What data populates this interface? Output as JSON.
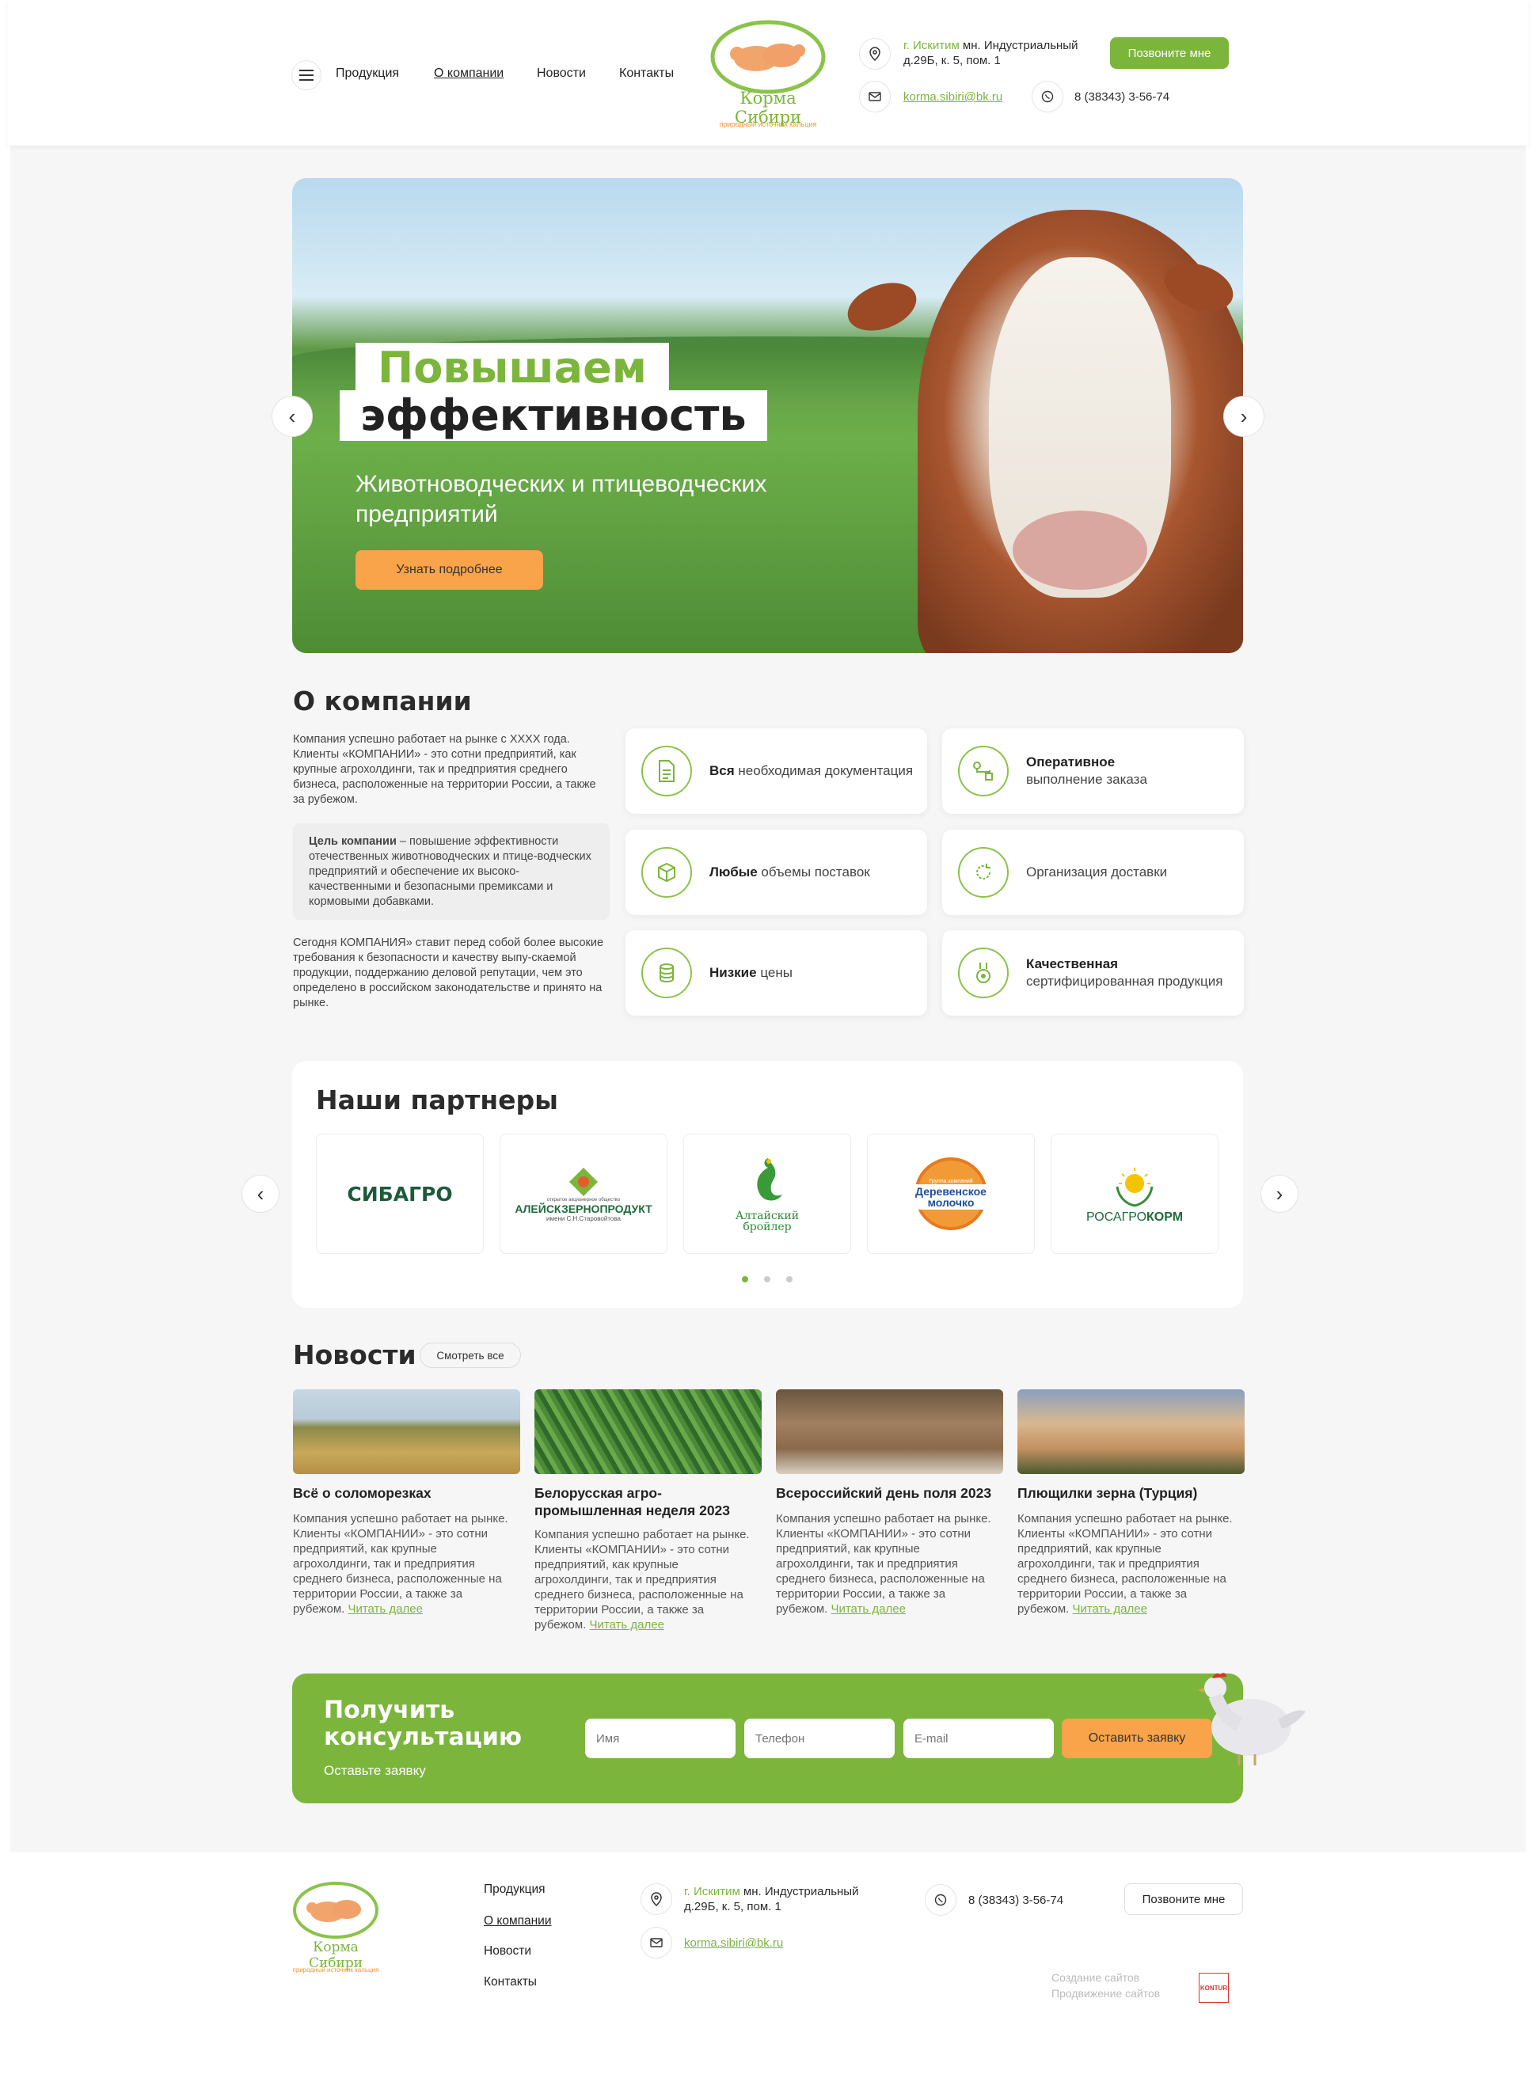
{
  "header": {
    "menu_label": "",
    "nav": [
      "Продукция",
      "О компании",
      "Новости",
      "Контакты"
    ],
    "logo_name": "Корма Сибири",
    "logo_tagline": "природный источник кальция",
    "address_city": "г. Искитим",
    "address_rest": " мн. Индустриальный",
    "address_line2": "д.29Б, к. 5, пом. 1",
    "email": "korma.sibiri@bk.ru",
    "phone": "8 (38343) 3-56-74",
    "callback_button": "Позвоните мне"
  },
  "hero": {
    "title_line1": "Повышаем",
    "title_line2": "эффективность",
    "subtitle": "Животноводческих и птицеводческих предприятий",
    "button": "Узнать подробнее"
  },
  "about": {
    "heading": "О компании",
    "para1": "Компания успешно работает на рынке с XXXX года. Клиенты «КОМПАНИИ» - это сотни предприятий, как крупные агрохолдинги, так и предприятия среднего бизнеса, расположенные на территории России, а также за рубежом.",
    "goal_bold": "Цель компании",
    "goal_text": " – повышение эффективности отечественных животноводческих и птице-водческих предприятий и обеспечение их высоко-качественными и безопасными премиксами и кормовыми добавками.",
    "para2": "Сегодня КОМПАНИЯ» ставит перед собой более высокие требования к безопасности и качеству выпу-скаемой продукции, поддержанию деловой репутации, чем это определено в российском законодательстве и принято на рынке.",
    "features": [
      {
        "bold": "Вся",
        "text": " необходимая документация",
        "icon": "document-icon"
      },
      {
        "bold": "Оперативное",
        "text": " выполнение заказа",
        "icon": "route-icon"
      },
      {
        "bold": "Любые",
        "text": " объемы поставок",
        "icon": "box-icon"
      },
      {
        "bold": "",
        "text": "Организация доставки",
        "icon": "refresh-icon"
      },
      {
        "bold": "Низкие",
        "text": " цены",
        "icon": "coins-icon"
      },
      {
        "bold": "Качественная",
        "text": " сертифицированная продукция",
        "icon": "medal-icon"
      }
    ]
  },
  "partners": {
    "heading": "Наши партнеры",
    "items": [
      {
        "name": "СИБАГРО"
      },
      {
        "name": "АЛЕЙСКЗЕРНОПРОДУКТ",
        "small_top": "открытое акционерное общество",
        "small_bottom": "имени С.Н.Старовойтова"
      },
      {
        "name": "Алтайский бройлер"
      },
      {
        "name": "Деревенское молочко",
        "small_top": "Группа компаний"
      },
      {
        "name_a": "РОСАГРО",
        "name_b": "КОРМ"
      }
    ]
  },
  "news": {
    "heading": "Новости",
    "see_all": "Смотреть все",
    "read_more": "Читать далее",
    "items": [
      {
        "title": "Всё о соломорезках",
        "text": "Компания успешно работает на рынке. Клиенты «КОМПАНИИ» - это сотни предприятий, как крупные агрохолдинги, так и предприятия среднего бизнеса, расположенные на территории России, а также за рубежом."
      },
      {
        "title": "Белорусская агро-промышленная неделя 2023",
        "text": "Компания успешно работает на рынке. Клиенты «КОМПАНИИ» - это сотни предприятий, как крупные агрохолдинги, так и предприятия среднего бизнеса, расположенные на территории России, а также за рубежом."
      },
      {
        "title": "Всероссийский день поля 2023",
        "text": "Компания успешно работает на рынке. Клиенты «КОМПАНИИ» - это сотни предприятий, как крупные агрохолдинги, так и предприятия среднего бизнеса, расположенные на территории России, а также за рубежом."
      },
      {
        "title": "Плющилки зерна (Турция)",
        "text": "Компания успешно работает на рынке. Клиенты «КОМПАНИИ» - это сотни предприятий, как крупные агрохолдинги, так и предприятия среднего бизнеса, расположенные на территории России, а также за рубежом."
      }
    ]
  },
  "consult": {
    "title": "Получить консультацию",
    "subtitle": "Оставьте заявку",
    "name_placeholder": "Имя",
    "phone_placeholder": "Телефон",
    "email_placeholder": "E-mail",
    "submit": "Оставить заявку"
  },
  "footer": {
    "nav": [
      "Продукция",
      "О компании",
      "Новости",
      "Контакты"
    ],
    "dev_line1": "Создание сайтов",
    "dev_line2": "Продвижение сайтов",
    "dev_logo": "KONTUR"
  },
  "colors": {
    "accent": "#7cb53c",
    "orange": "#f9a34a"
  }
}
